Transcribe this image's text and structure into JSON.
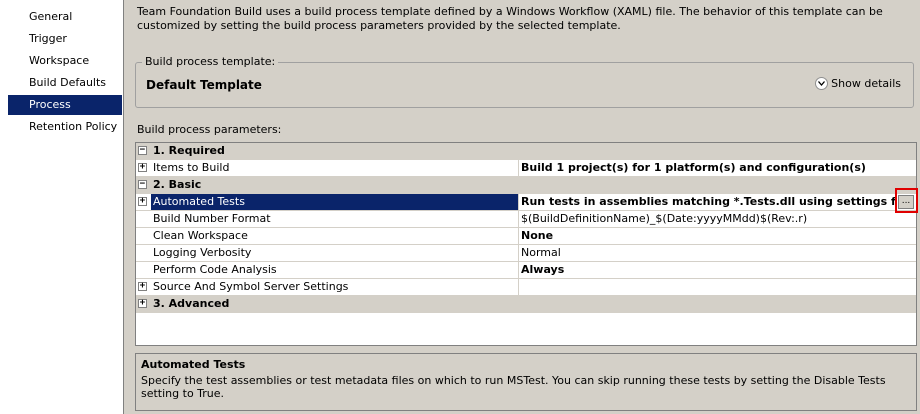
{
  "nav": {
    "items": [
      {
        "label": "General",
        "selected": false
      },
      {
        "label": "Trigger",
        "selected": false
      },
      {
        "label": "Workspace",
        "selected": false
      },
      {
        "label": "Build Defaults",
        "selected": false
      },
      {
        "label": "Process",
        "selected": true
      },
      {
        "label": "Retention Policy",
        "selected": false
      }
    ]
  },
  "intro_text": "Team Foundation Build uses a build process template defined by a Windows Workflow (XAML) file. The behavior of this template can be customized by setting the build process parameters provided by the selected template.",
  "template": {
    "legend": "Build process template:",
    "name": "Default Template",
    "show_details": "Show details"
  },
  "params": {
    "label": "Build process parameters:",
    "categories": [
      {
        "label": "1. Required",
        "expander": "−"
      },
      {
        "label": "2. Basic",
        "expander": "−"
      },
      {
        "label": "3. Advanced",
        "expander": "+"
      }
    ],
    "rows": [
      {
        "name": "Items to Build",
        "value": "Build 1 project(s) for 1 platform(s) and configuration(s)",
        "expander": "+"
      },
      {
        "name": "Automated Tests",
        "value": "Run tests in assemblies matching *.Tests.dll using settings from $/C",
        "expander": "+",
        "ellipsis": "..."
      },
      {
        "name": "Build Number Format",
        "value": "$(BuildDefinitionName)_$(Date:yyyyMMdd)$(Rev:.r)"
      },
      {
        "name": "Clean Workspace",
        "value": "None"
      },
      {
        "name": "Logging Verbosity",
        "value": "Normal"
      },
      {
        "name": "Perform Code Analysis",
        "value": "Always"
      },
      {
        "name": "Source And Symbol Server Settings",
        "value": "",
        "expander": "+"
      }
    ]
  },
  "description": {
    "title": "Automated Tests",
    "text": "Specify the test assemblies or test metadata files on which to run MSTest. You can skip running these tests by setting the Disable Tests setting to True."
  },
  "colors": {
    "selection": "#0a246a",
    "panel": "#d4d0c8",
    "highlight": "#e00000"
  }
}
